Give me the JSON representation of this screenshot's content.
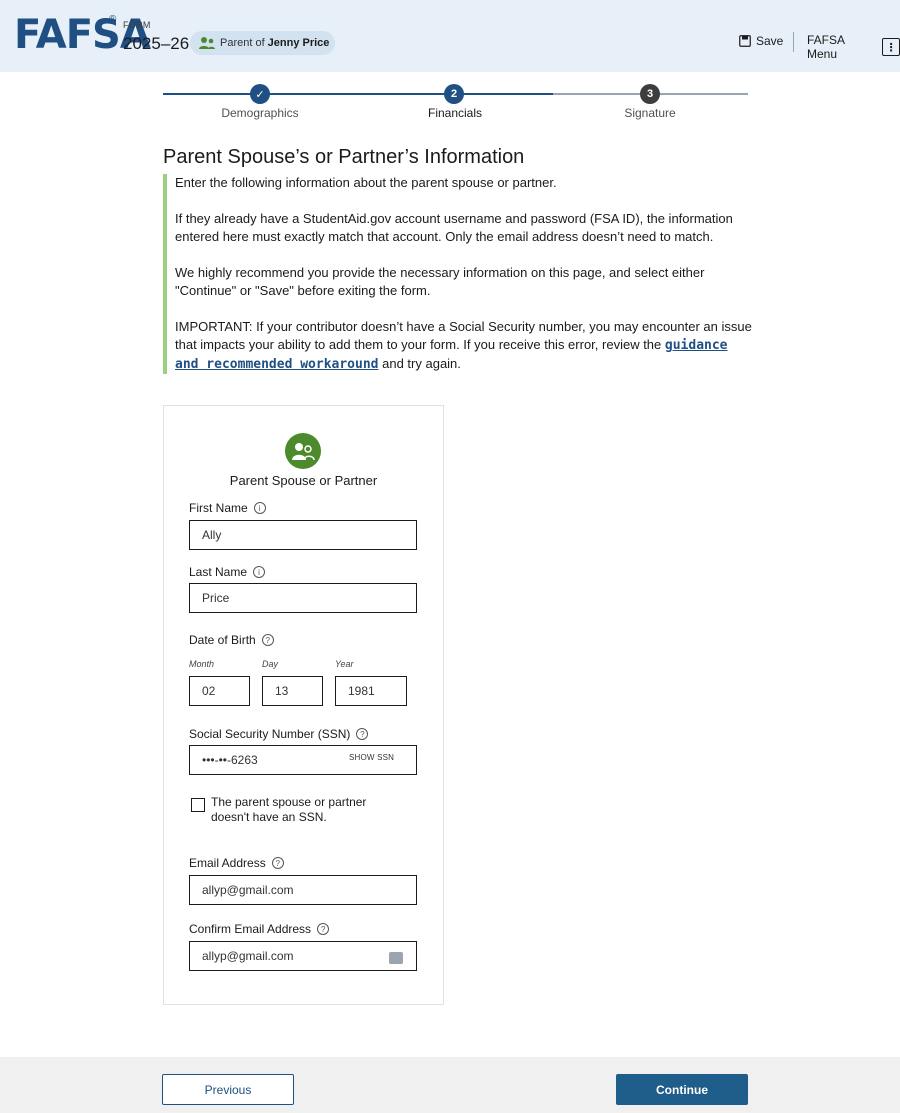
{
  "header": {
    "logo": "FAFSA",
    "logo_mark": "®",
    "form_label": "FORM",
    "form_year": "2025–26",
    "parent_prefix": "Parent of",
    "parent_name": "Jenny Price",
    "save_label": "Save",
    "menu_label": "FAFSA Menu",
    "menu_icon_glyph": "⋮"
  },
  "stepper": {
    "steps": [
      {
        "label": "Demographics",
        "marker": "✓",
        "state": "complete"
      },
      {
        "label": "Financials",
        "marker": "2",
        "state": "current"
      },
      {
        "label": "Signature",
        "marker": "3",
        "state": "upcoming"
      }
    ]
  },
  "page": {
    "title": "Parent Spouse’s or Partner’s Information",
    "intro": {
      "p1": "Enter the following information about the parent spouse or partner.",
      "p2": "If they already have a StudentAid.gov account username and password (FSA ID), the information entered here must exactly match that account. Only the email address doesn’t need to match.",
      "p3": "We highly recommend you provide the necessary information on this page, and select either \"Continue\" or \"Save\" before exiting the form.",
      "p4_before": "IMPORTANT: If your contributor doesn’t have a Social Security number, you may encounter an issue that impacts your ability to add them to your form. If you receive this error, review the",
      "p4_link": "guidance and recommended workaround",
      "p4_after": "and try again."
    }
  },
  "card": {
    "title": "Parent Spouse or Partner",
    "first_name": {
      "label": "First Name",
      "value": "Ally"
    },
    "last_name": {
      "label": "Last Name",
      "value": "Price"
    },
    "dob": {
      "label": "Date of Birth",
      "month_label": "Month",
      "month_value": "02",
      "day_label": "Day",
      "day_value": "13",
      "year_label": "Year",
      "year_value": "1981"
    },
    "ssn": {
      "label": "Social Security Number (SSN)",
      "value": "•••-••-6263",
      "show_label": "SHOW SSN"
    },
    "no_ssn": {
      "label": "The parent spouse or partner doesn't have an SSN.",
      "checked": false
    },
    "email": {
      "label": "Email Address",
      "value": "allyp@gmail.com"
    },
    "confirm_email": {
      "label": "Confirm Email Address",
      "value": "allyp@gmail.com"
    }
  },
  "footer": {
    "previous_label": "Previous",
    "continue_label": "Continue"
  },
  "colors": {
    "brand": "#1f4f83",
    "header_bg": "#e7f0f8",
    "accent_green": "#4d8a2b",
    "callout_border": "#9bd080",
    "continue_bg": "#1f5d8a"
  }
}
